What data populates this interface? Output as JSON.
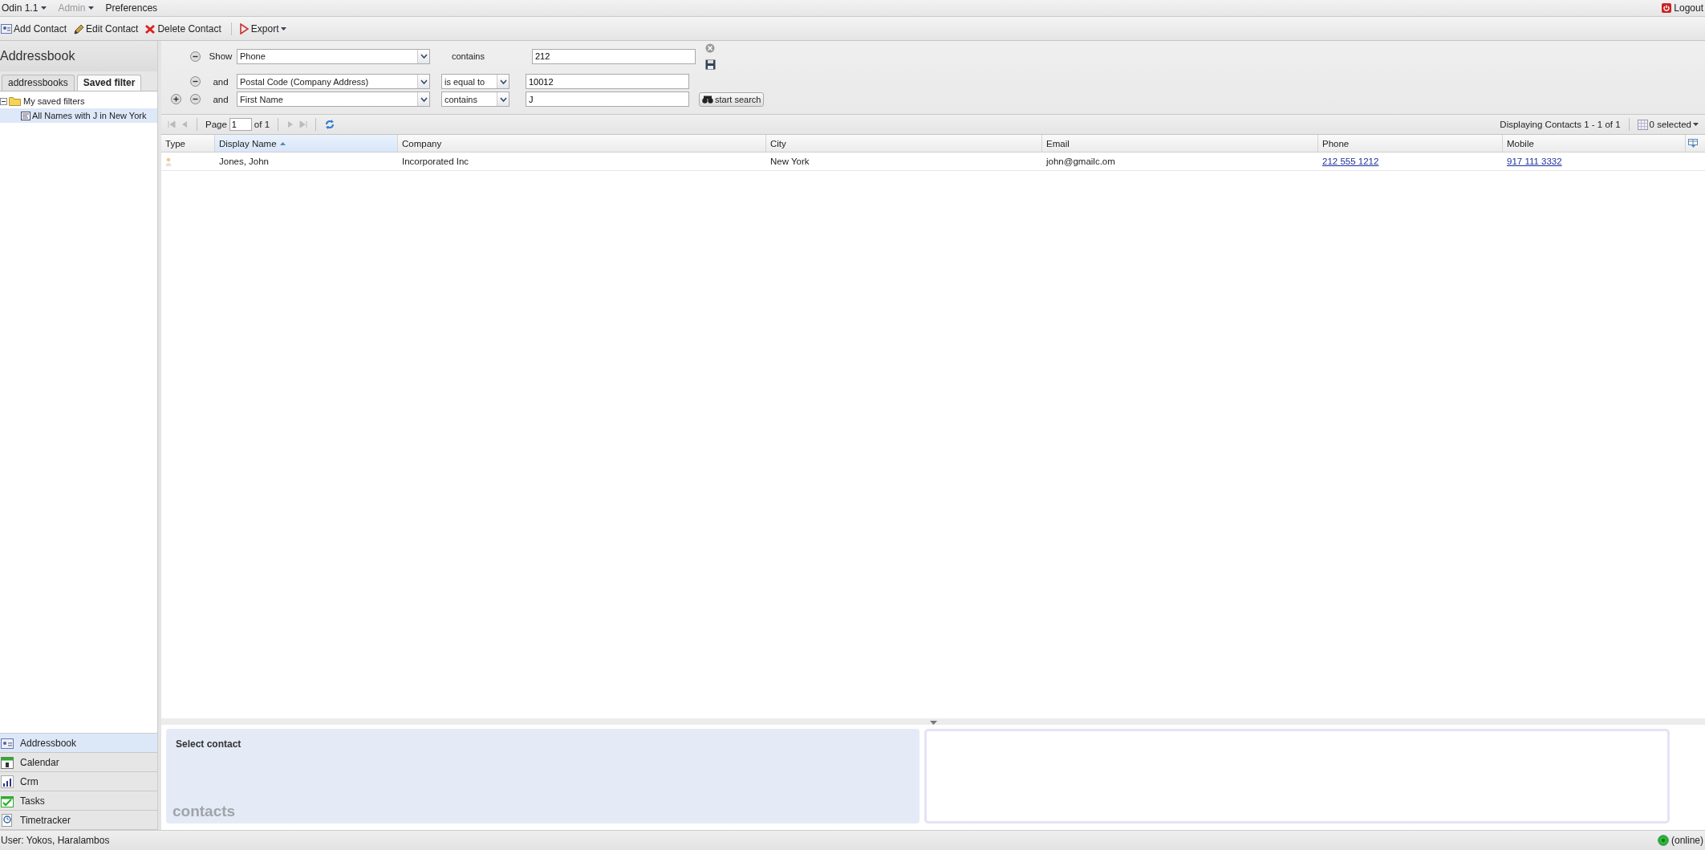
{
  "menu_bar": {
    "items": [
      {
        "label": "Odin 1.1",
        "dropdown": true,
        "disabled": false
      },
      {
        "label": "Admin",
        "dropdown": true,
        "disabled": true
      },
      {
        "label": "Preferences",
        "dropdown": false,
        "disabled": false
      }
    ],
    "logout": "Logout"
  },
  "toolbar": [
    {
      "label": "Add Contact",
      "kind": "add",
      "dropdown": false
    },
    {
      "label": "Edit Contact",
      "kind": "edit",
      "dropdown": false
    },
    {
      "label": "Delete Contact",
      "kind": "delete",
      "dropdown": false
    },
    {
      "label": "Export",
      "kind": "export",
      "dropdown": true
    }
  ],
  "sidebar": {
    "title": "Addressbook",
    "tabs": [
      {
        "label": "addressbooks",
        "selected": false
      },
      {
        "label": "Saved filter",
        "selected": true
      }
    ],
    "tree": [
      {
        "label": "My saved filters",
        "kind": "folder",
        "expanded": true,
        "selected": false,
        "children": [
          {
            "label": "All Names with J in New York",
            "kind": "filter",
            "selected": true
          }
        ]
      }
    ],
    "modules": [
      {
        "label": "Addressbook",
        "kind": "addressbook",
        "selected": true
      },
      {
        "label": "Calendar",
        "kind": "calendar",
        "selected": false
      },
      {
        "label": "Crm",
        "kind": "crm",
        "selected": false
      },
      {
        "label": "Tasks",
        "kind": "tasks",
        "selected": false
      },
      {
        "label": "Timetracker",
        "kind": "timetracker",
        "selected": false
      }
    ]
  },
  "filter": {
    "rows": [
      {
        "connector": "Show",
        "field": "Phone",
        "operator": "contains",
        "kind": "plain",
        "value": "212",
        "can_add": false
      },
      {
        "connector": "and",
        "field": "Postal Code (Company Address)",
        "operator": "is equal to",
        "kind": "select",
        "value": "10012",
        "can_add": false
      },
      {
        "connector": "and",
        "field": "First Name",
        "operator": "contains",
        "kind": "select",
        "value": "J",
        "can_add": true
      }
    ],
    "search_button": "start search"
  },
  "paging": {
    "page_label": "Page",
    "page": "1",
    "of": "of 1",
    "display": "Displaying Contacts 1 - 1 of 1",
    "selected_count": "0 selected"
  },
  "table": {
    "columns": [
      {
        "label": "Type",
        "kind": "icon",
        "sorted": false
      },
      {
        "label": "Display Name",
        "kind": "text",
        "sorted": true
      },
      {
        "label": "Company",
        "kind": "text",
        "sorted": false
      },
      {
        "label": "City",
        "kind": "text",
        "sorted": false
      },
      {
        "label": "Email",
        "kind": "text",
        "sorted": false
      },
      {
        "label": "Phone",
        "kind": "link",
        "sorted": false
      },
      {
        "label": "Mobile",
        "kind": "link",
        "sorted": false
      }
    ],
    "rows": [
      {
        "cells": [
          "",
          "Jones, John",
          "Incorporated Inc",
          "New York",
          "john@gmailc.om",
          "212 555 1212",
          "917 111 3332"
        ]
      }
    ]
  },
  "detail": {
    "title": "Select contact",
    "watermark": "contacts"
  },
  "status_bar": {
    "user": "User: Yokos, Haralambos",
    "status": "(online)",
    "online": true
  }
}
